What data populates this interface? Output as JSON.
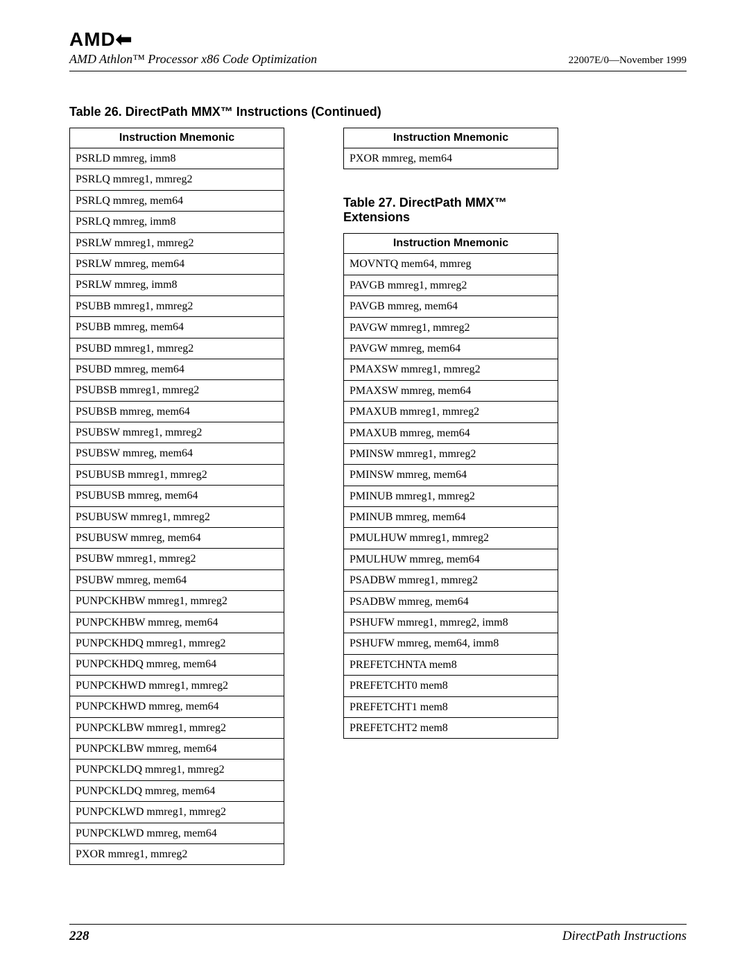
{
  "header": {
    "logo_text": "AMD",
    "doc_title": "AMD Athlon™ Processor x86 Code Optimization",
    "doc_id": "22007E/0—November 1999"
  },
  "section26": {
    "title": "Table 26. DirectPath MMX™ Instructions (Continued)",
    "col_header": "Instruction Mnemonic",
    "left_rows": [
      "PSRLD mmreg, imm8",
      "PSRLQ mmreg1, mmreg2",
      "PSRLQ mmreg, mem64",
      "PSRLQ mmreg, imm8",
      "PSRLW mmreg1, mmreg2",
      "PSRLW mmreg, mem64",
      "PSRLW mmreg, imm8",
      "PSUBB mmreg1, mmreg2",
      "PSUBB mmreg, mem64",
      "PSUBD mmreg1, mmreg2",
      "PSUBD mmreg, mem64",
      "PSUBSB mmreg1, mmreg2",
      "PSUBSB mmreg, mem64",
      "PSUBSW mmreg1, mmreg2",
      "PSUBSW mmreg, mem64",
      "PSUBUSB mmreg1, mmreg2",
      "PSUBUSB mmreg, mem64",
      "PSUBUSW mmreg1, mmreg2",
      "PSUBUSW mmreg, mem64",
      "PSUBW mmreg1, mmreg2",
      "PSUBW mmreg, mem64",
      "PUNPCKHBW mmreg1, mmreg2",
      "PUNPCKHBW mmreg, mem64",
      "PUNPCKHDQ mmreg1, mmreg2",
      "PUNPCKHDQ mmreg, mem64",
      "PUNPCKHWD mmreg1, mmreg2",
      "PUNPCKHWD mmreg, mem64",
      "PUNPCKLBW mmreg1, mmreg2",
      "PUNPCKLBW mmreg, mem64",
      "PUNPCKLDQ mmreg1, mmreg2",
      "PUNPCKLDQ mmreg, mem64",
      "PUNPCKLWD mmreg1, mmreg2",
      "PUNPCKLWD mmreg, mem64",
      "PXOR mmreg1, mmreg2"
    ],
    "right_rows": [
      "PXOR mmreg, mem64"
    ]
  },
  "section27": {
    "title": "Table 27. DirectPath MMX™ Extensions",
    "col_header": "Instruction Mnemonic",
    "rows": [
      "MOVNTQ mem64, mmreg",
      "PAVGB mmreg1, mmreg2",
      "PAVGB mmreg, mem64",
      "PAVGW mmreg1, mmreg2",
      "PAVGW mmreg, mem64",
      "PMAXSW mmreg1, mmreg2",
      "PMAXSW mmreg, mem64",
      "PMAXUB mmreg1, mmreg2",
      "PMAXUB mmreg, mem64",
      "PMINSW mmreg1, mmreg2",
      "PMINSW mmreg, mem64",
      "PMINUB mmreg1, mmreg2",
      "PMINUB mmreg, mem64",
      "PMULHUW mmreg1, mmreg2",
      "PMULHUW mmreg, mem64",
      "PSADBW mmreg1, mmreg2",
      "PSADBW mmreg, mem64",
      "PSHUFW mmreg1, mmreg2, imm8",
      "PSHUFW mmreg, mem64, imm8",
      "PREFETCHNTA mem8",
      "PREFETCHT0 mem8",
      "PREFETCHT1 mem8",
      "PREFETCHT2 mem8"
    ]
  },
  "footer": {
    "page_number": "228",
    "section_name": "DirectPath Instructions"
  }
}
